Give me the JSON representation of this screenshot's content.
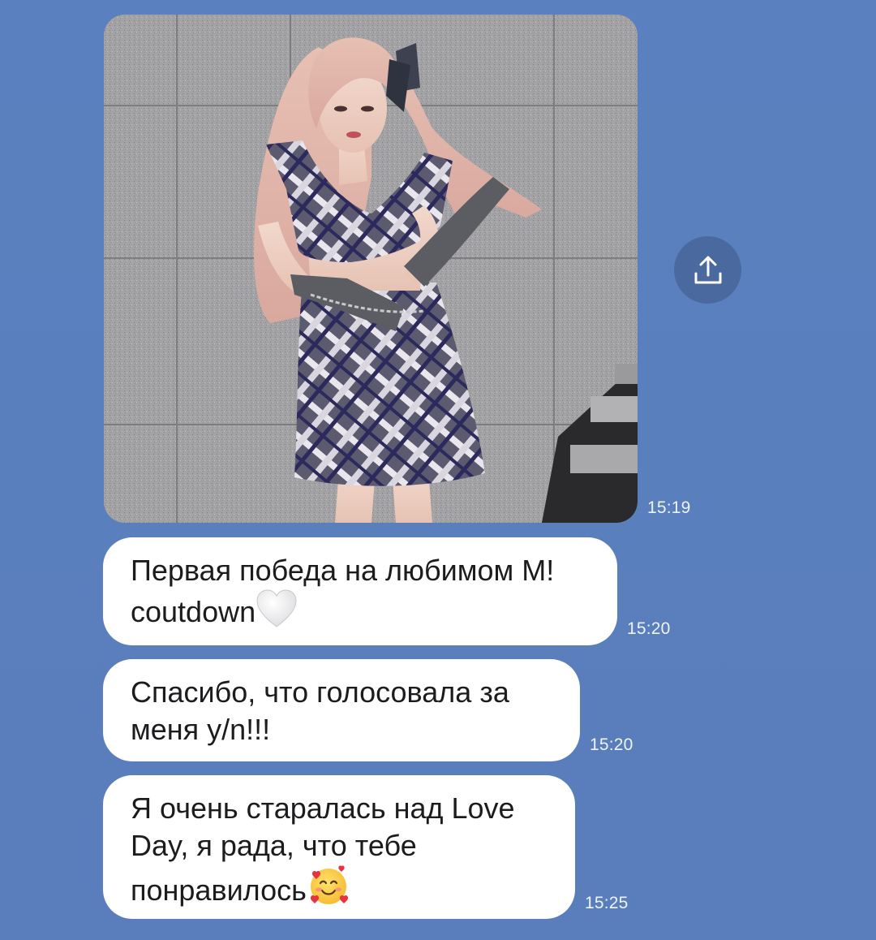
{
  "messages": [
    {
      "type": "photo",
      "time": "15:19"
    },
    {
      "type": "text",
      "line1": "Первая победа на любимом M!",
      "line2": "coutdown",
      "emoji": "white-heart-icon",
      "time": "15:20"
    },
    {
      "type": "text",
      "line1": "Спасибо, что голосовала за",
      "line2": "меня y/n!!!",
      "time": "15:20"
    },
    {
      "type": "text",
      "line1": "Я очень старалась над Love",
      "line2": "Day, я рада, что тебе",
      "line3": "понравилось",
      "emoji": "smiling-face-with-hearts-icon",
      "time": "15:25"
    }
  ],
  "share": {
    "icon": "share-upload-icon"
  },
  "colors": {
    "background": "#5a7fbd",
    "bubble": "#ffffff",
    "share_button": "#4a6a9f",
    "timestamp": "#eef3fb"
  }
}
